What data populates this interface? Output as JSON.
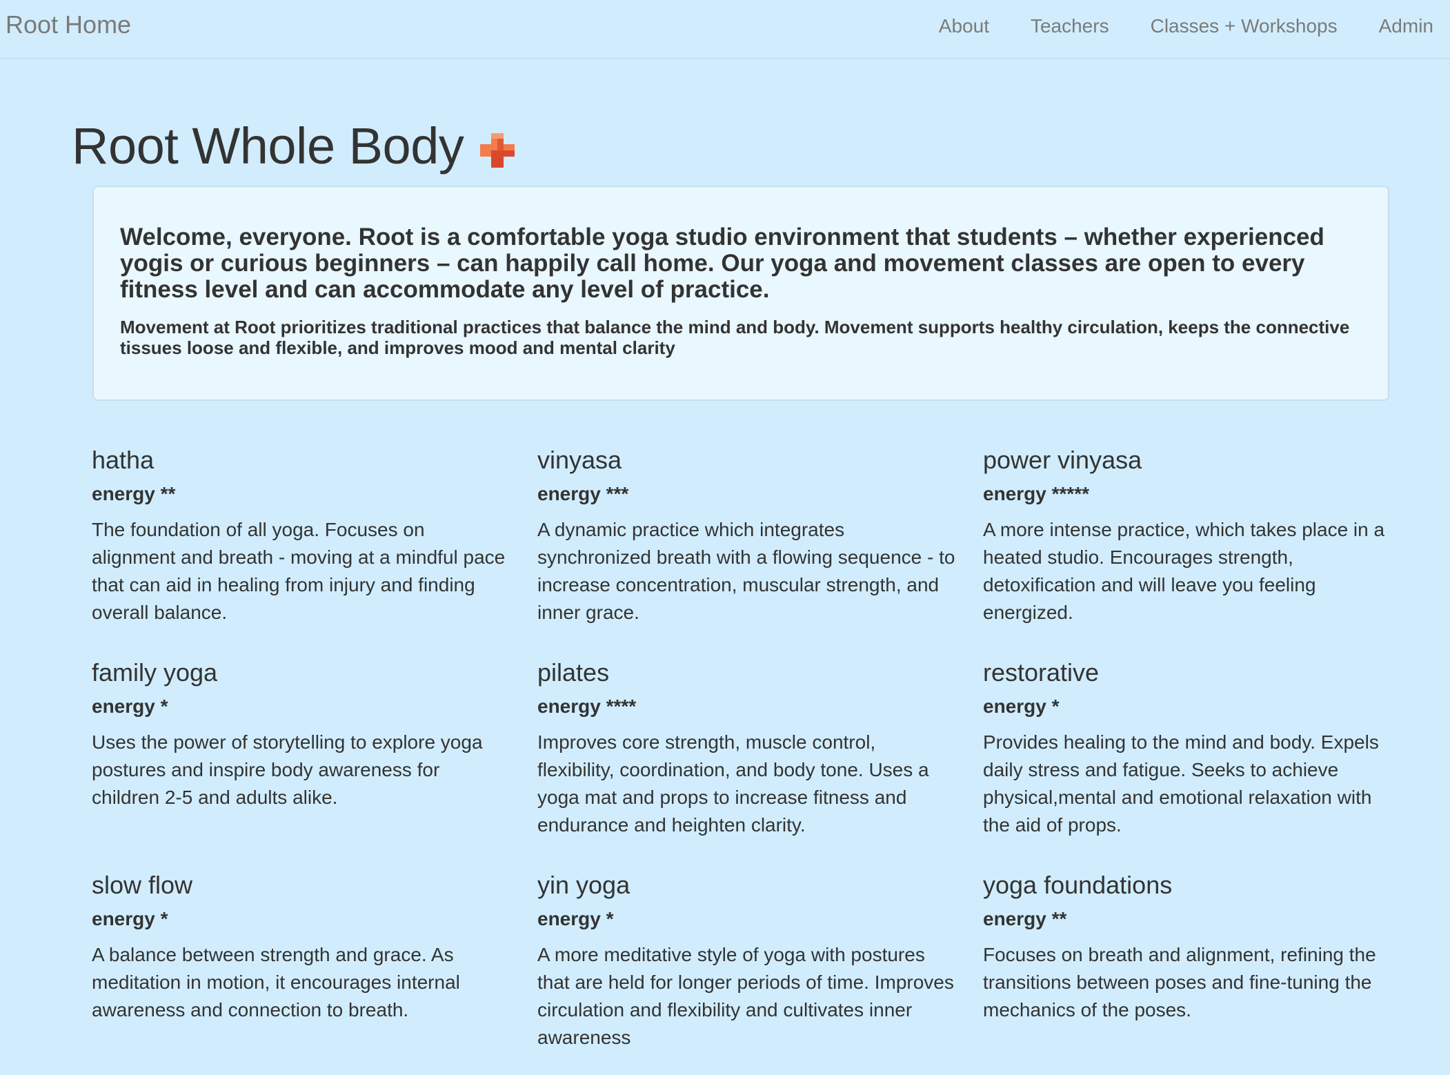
{
  "nav": {
    "brand": "Root Home",
    "links": [
      "About",
      "Teachers",
      "Classes + Workshops",
      "Admin"
    ]
  },
  "header": {
    "title": "Root Whole Body",
    "icon": "plus-icon",
    "icon_colors": [
      "#f47b4a",
      "#d9482a"
    ]
  },
  "intro": {
    "lead": "Welcome, everyone. Root is a comfortable yoga studio environment that students – whether experienced yogis or curious beginners – can happily call home. Our yoga and movement classes are open to every fitness level and can accommodate any level of practice.",
    "sub": "Movement at Root prioritizes traditional practices that balance the mind and body. Movement supports healthy circulation, keeps the connective tissues loose and flexible, and improves mood and mental clarity"
  },
  "classes": [
    {
      "name": "hatha",
      "energy": "energy **",
      "desc": "The foundation of all yoga. Focuses on alignment and breath - moving at a mindful pace that can aid in healing from injury and finding overall balance."
    },
    {
      "name": "vinyasa",
      "energy": "energy ***",
      "desc": "A dynamic practice which integrates synchronized breath with a flowing sequence - to increase concentration, muscular strength, and inner grace."
    },
    {
      "name": "power vinyasa",
      "energy": "energy *****",
      "desc": "A more intense practice, which takes place in a heated studio. Encourages strength, detoxification and will leave you feeling energized."
    },
    {
      "name": "family yoga",
      "energy": "energy *",
      "desc": "Uses the power of storytelling to explore yoga postures and inspire body awareness for children 2-5 and adults alike."
    },
    {
      "name": "pilates",
      "energy": "energy ****",
      "desc": "Improves core strength, muscle control, flexibility, coordination, and body tone. Uses a yoga mat and props to increase fitness and endurance and heighten clarity."
    },
    {
      "name": "restorative",
      "energy": "energy *",
      "desc": "Provides healing to the mind and body. Expels daily stress and fatigue. Seeks to achieve physical,mental and emotional relaxation with the aid of props."
    },
    {
      "name": "slow flow",
      "energy": "energy *",
      "desc": "A balance between strength and grace. As meditation in motion, it encourages internal awareness and connection to breath."
    },
    {
      "name": "yin yoga",
      "energy": "energy *",
      "desc": "A more meditative style of yoga with postures that are held for longer periods of time. Improves circulation and flexibility and cultivates inner awareness"
    },
    {
      "name": "yoga foundations",
      "energy": "energy **",
      "desc": "Focuses on breath and alignment, refining the transitions between poses and fine-tuning the mechanics of the poses."
    }
  ]
}
